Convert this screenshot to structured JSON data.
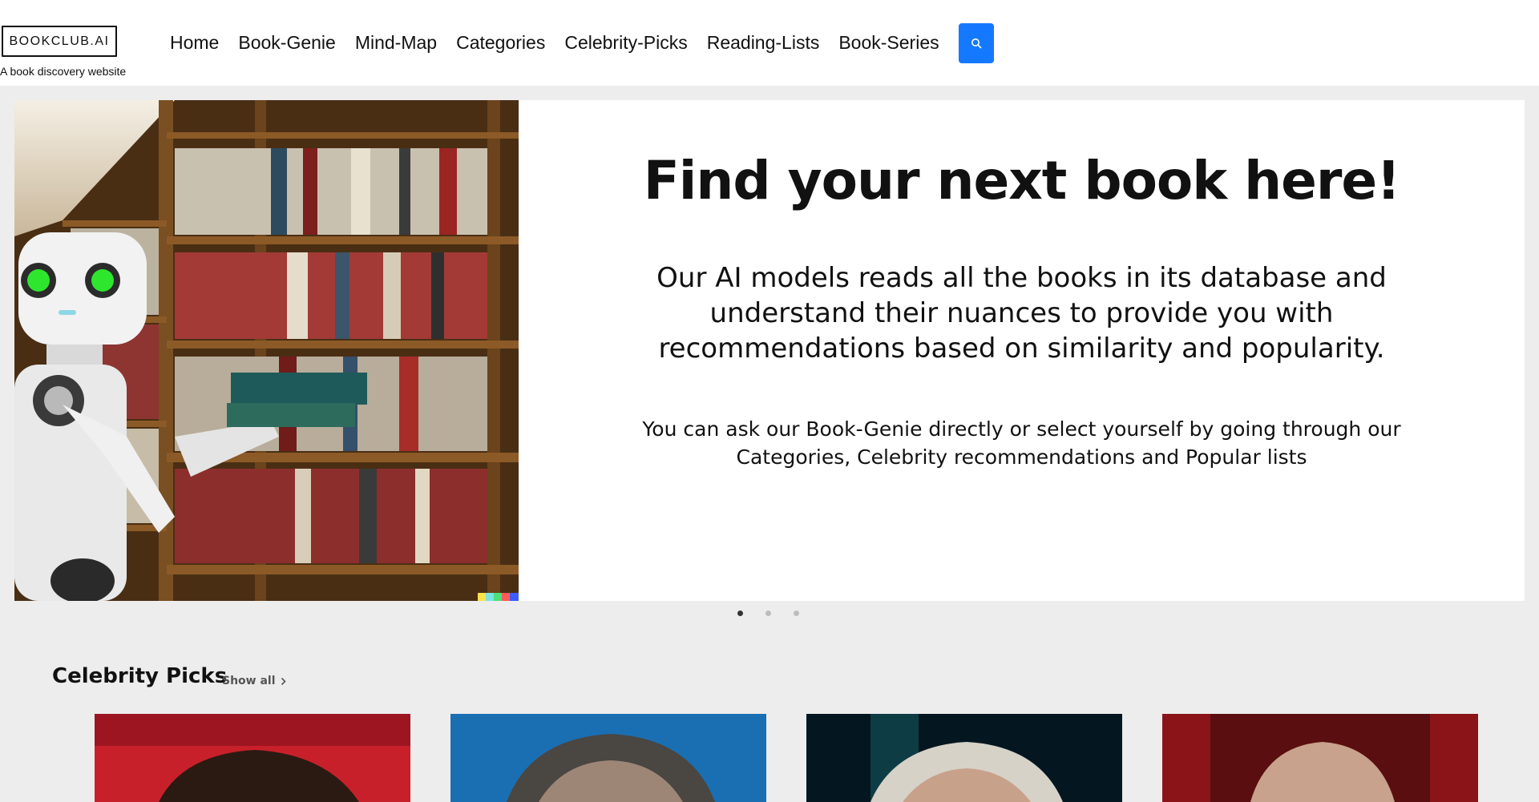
{
  "header": {
    "logo_text": "BOOKCLUB.AI",
    "tagline": "A book discovery website",
    "nav": [
      "Home",
      "Book-Genie",
      "Mind-Map",
      "Categories",
      "Celebrity-Picks",
      "Reading-Lists",
      "Book-Series"
    ],
    "search_icon": "search-icon",
    "accent_color": "#1479ff"
  },
  "hero": {
    "title": "Find your next book here!",
    "subtitle": "Our AI models reads all the books in its database and understand their nuances to provide you with recommendations based on similarity and popularity.",
    "description": "You can ask our Book-Genie directly or select yourself by going through our Categories, Celebrity recommendations and Popular lists",
    "slide_count": 3,
    "active_slide": 1
  },
  "celebrity": {
    "title": "Celebrity Picks",
    "show_all": "Show all",
    "chevron_icon": "chevron-right-icon"
  }
}
